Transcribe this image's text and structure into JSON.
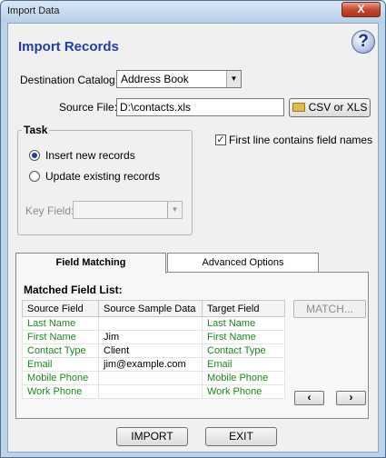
{
  "window": {
    "title": "Import Data",
    "close_glyph": "X"
  },
  "header": {
    "heading": "Import Records",
    "help_glyph": "?"
  },
  "destination": {
    "label": "Destination Catalog:",
    "value": "Address Book"
  },
  "source": {
    "label": "Source File:",
    "value": "D:\\contacts.xls",
    "browse_label": "CSV or XLS"
  },
  "task": {
    "title": "Task",
    "options": [
      {
        "label": "Insert new records",
        "selected": true
      },
      {
        "label": "Update existing records",
        "selected": false
      }
    ],
    "key_field_label": "Key Field:",
    "key_field_value": ""
  },
  "first_line": {
    "label": "First line contains field names",
    "checked": true,
    "check_glyph": "✓"
  },
  "tabs": [
    {
      "label": "Field Matching",
      "active": true
    },
    {
      "label": "Advanced Options",
      "active": false
    }
  ],
  "matching": {
    "list_title": "Matched Field List:",
    "columns": [
      "Source Field",
      "Source Sample Data",
      "Target Field"
    ],
    "rows": [
      {
        "source": "Last Name",
        "sample": "",
        "target": "Last Name"
      },
      {
        "source": "First Name",
        "sample": "Jim",
        "target": "First Name"
      },
      {
        "source": "Contact Type",
        "sample": "Client",
        "target": "Contact Type"
      },
      {
        "source": "Email",
        "sample": "jim@example.com",
        "target": "Email"
      },
      {
        "source": "Mobile Phone",
        "sample": "",
        "target": "Mobile Phone"
      },
      {
        "source": "Work Phone",
        "sample": "",
        "target": "Work Phone"
      }
    ],
    "match_button": "MATCH...",
    "prev_glyph": "‹",
    "next_glyph": "›"
  },
  "footer": {
    "import_label": "IMPORT",
    "exit_label": "EXIT"
  }
}
